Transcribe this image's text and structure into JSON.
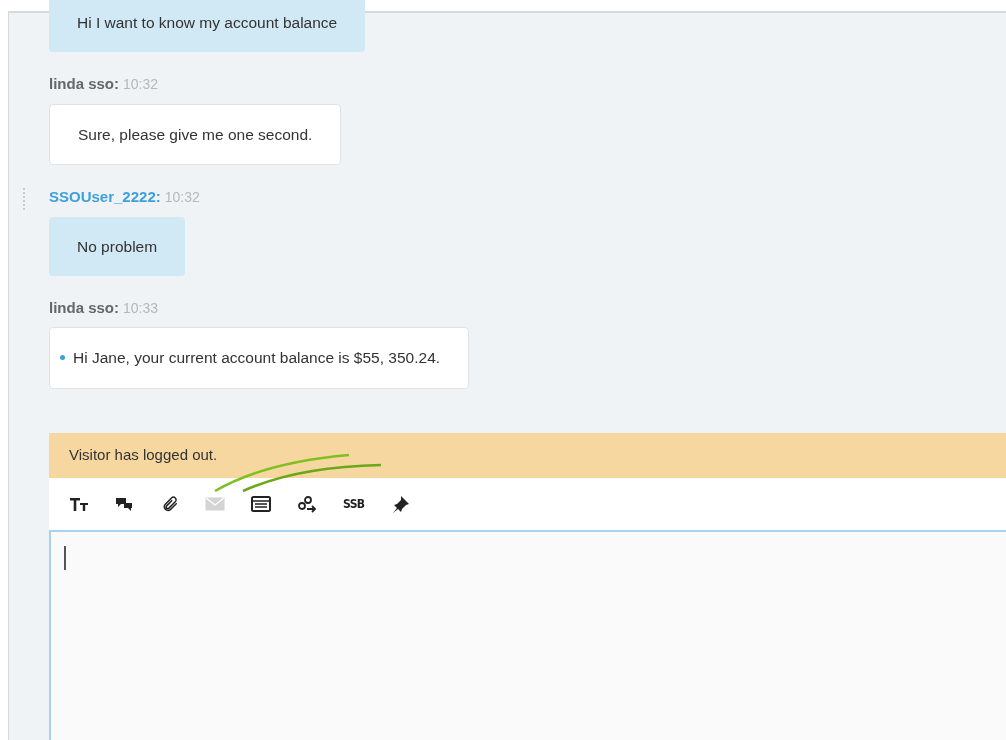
{
  "messages": [
    {
      "kind": "visitor",
      "text": "Hi I want to know my account balance",
      "bulleted": false
    },
    {
      "kind": "agent",
      "sender": "linda sso:",
      "time": "10:32",
      "text": "Sure, please give me one second.",
      "bulleted": false
    },
    {
      "kind": "visitor",
      "sender": "SSOUser_2222:",
      "time": "10:32",
      "text": "No problem",
      "bulleted": false
    },
    {
      "kind": "agent",
      "sender": "linda sso:",
      "time": "10:33",
      "text": "Hi Jane, your current account balance is $55, 350.24.",
      "bulleted": true
    }
  ],
  "notice": "Visitor has logged out.",
  "toolbar": [
    {
      "kind": "text-size",
      "disabled": false
    },
    {
      "kind": "canned",
      "disabled": false
    },
    {
      "kind": "attach",
      "disabled": false
    },
    {
      "kind": "email",
      "disabled": true
    },
    {
      "kind": "form",
      "disabled": false
    },
    {
      "kind": "transfer",
      "disabled": false
    },
    {
      "kind": "label",
      "label": "SSB",
      "disabled": false
    },
    {
      "kind": "pin",
      "disabled": false
    }
  ]
}
